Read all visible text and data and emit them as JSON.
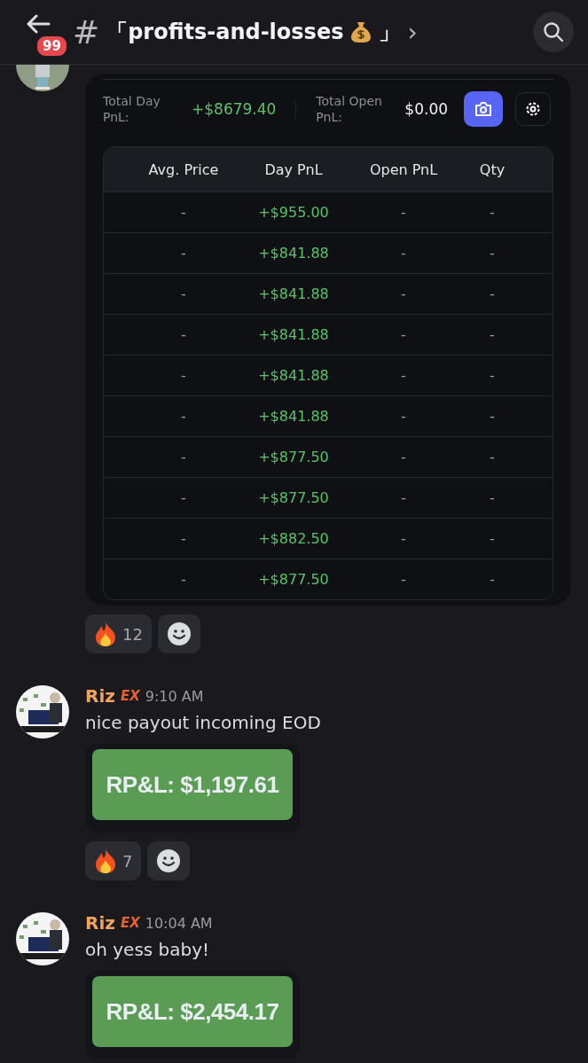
{
  "header": {
    "unread_badge": "99",
    "hash": "#",
    "title_open": "「profits-and-losses",
    "title_close": "」",
    "chevron": "›"
  },
  "pnl_card": {
    "total_day_label": "Total Day PnL:",
    "total_day_value": "+$8679.40",
    "total_open_label": "Total Open PnL:",
    "total_open_value": "$0.00",
    "table": {
      "columns": [
        "Avg. Price",
        "Day PnL",
        "Open PnL",
        "Qty"
      ],
      "rows": [
        [
          "-",
          "+$955.00",
          "-",
          "-"
        ],
        [
          "-",
          "+$841.88",
          "-",
          "-"
        ],
        [
          "-",
          "+$841.88",
          "-",
          "-"
        ],
        [
          "-",
          "+$841.88",
          "-",
          "-"
        ],
        [
          "-",
          "+$841.88",
          "-",
          "-"
        ],
        [
          "-",
          "+$841.88",
          "-",
          "-"
        ],
        [
          "-",
          "+$877.50",
          "-",
          "-"
        ],
        [
          "-",
          "+$877.50",
          "-",
          "-"
        ],
        [
          "-",
          "+$882.50",
          "-",
          "-"
        ],
        [
          "-",
          "+$877.50",
          "-",
          "-"
        ]
      ]
    }
  },
  "reactions_1": [
    {
      "kind": "fire",
      "count": "12"
    },
    {
      "kind": "add"
    }
  ],
  "messages": [
    {
      "author": "Riz",
      "tag": "EX",
      "time": "9:10 AM",
      "text": "nice payout incoming EOD",
      "attachment": "RP&L: $1,197.61",
      "reactions": [
        {
          "kind": "fire",
          "count": "7"
        },
        {
          "kind": "add"
        }
      ]
    },
    {
      "author": "Riz",
      "tag": "EX",
      "time": "10:04 AM",
      "text": "oh yess baby!",
      "attachment": "RP&L: $2,454.17"
    }
  ]
}
